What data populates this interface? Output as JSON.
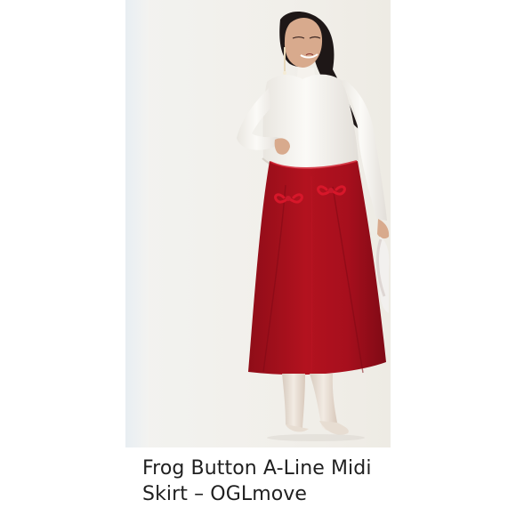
{
  "product": {
    "title_line_1": "Frog Button A-Line Midi",
    "title_line_2": "Skirt – OGLmove",
    "image_alt": "Model wearing white mock neck top, red frog button A-line midi skirt and cream boots"
  },
  "colors": {
    "background": "#ffffff",
    "image_background": "#f1f0ec",
    "skirt": "#a9121f",
    "top": "#f7f4ef",
    "boots": "#ece4da",
    "hair": "#1e1717",
    "skin": "#d8aa8d",
    "title_text": "#1f1f1f"
  },
  "icons": {
    "frog_button": "frog-button-icon",
    "handbag": "handbag-icon"
  }
}
